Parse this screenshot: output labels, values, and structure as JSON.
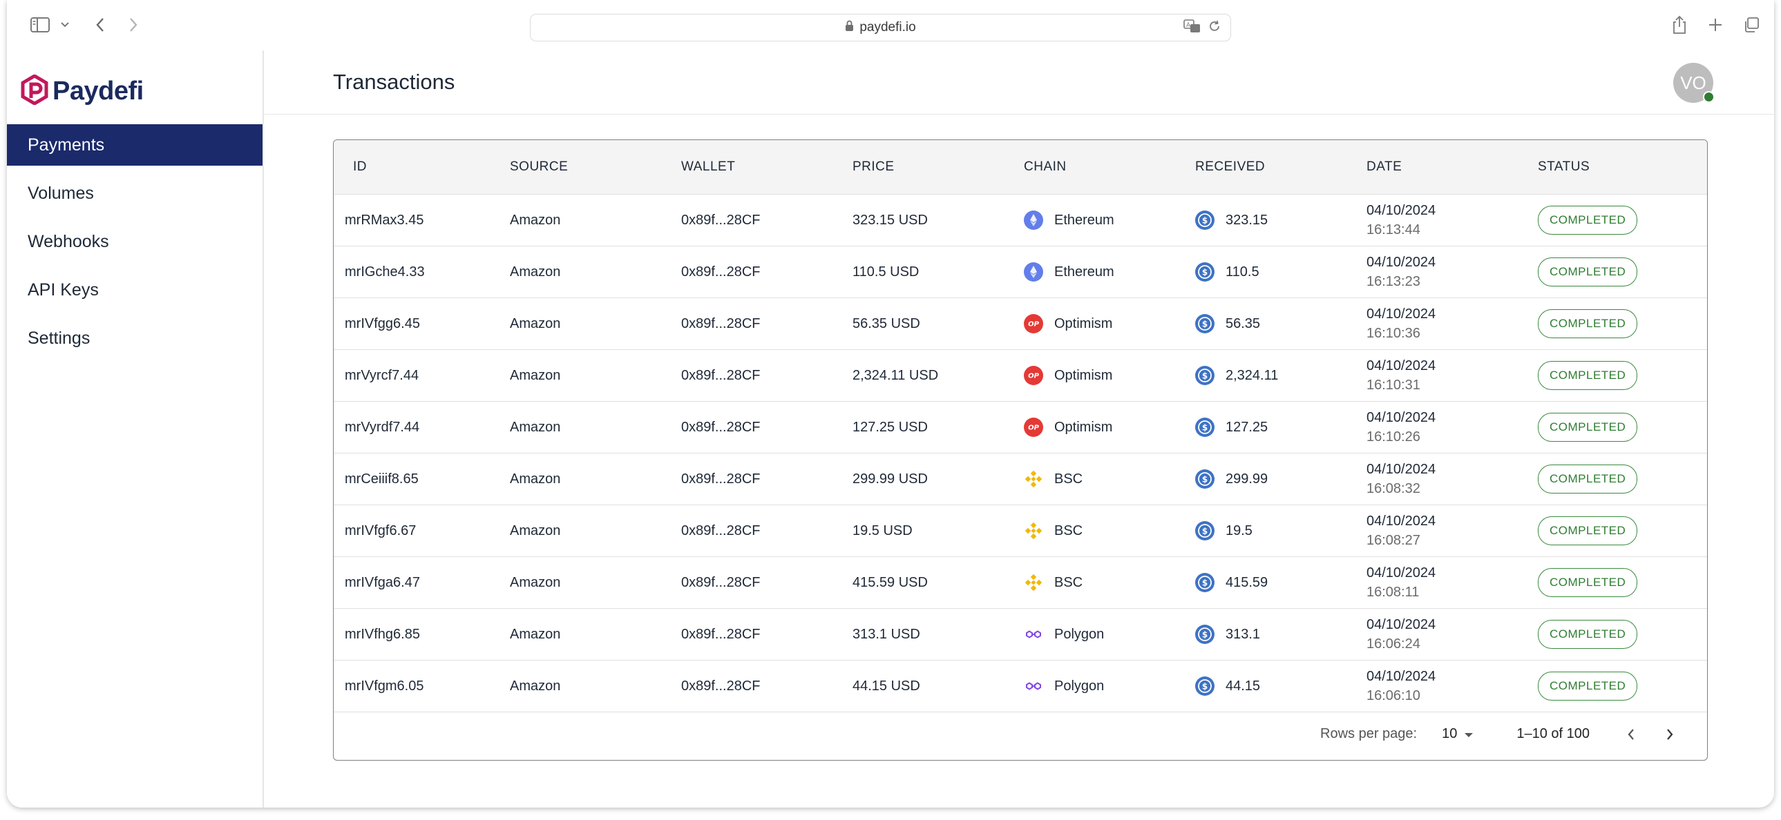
{
  "browser": {
    "url": "paydefi.io"
  },
  "brand": {
    "name": "Paydefi",
    "primary_color": "#1b2a6b",
    "logo_color": "#c2185b"
  },
  "sidebar": {
    "items": [
      {
        "label": "Payments",
        "active": true
      },
      {
        "label": "Volumes",
        "active": false
      },
      {
        "label": "Webhooks",
        "active": false
      },
      {
        "label": "API Keys",
        "active": false
      },
      {
        "label": "Settings",
        "active": false
      }
    ]
  },
  "header": {
    "title": "Transactions",
    "avatar_initials": "VO",
    "online_status_color": "#2e7d32"
  },
  "table": {
    "columns": [
      "ID",
      "SOURCE",
      "WALLET",
      "PRICE",
      "CHAIN",
      "RECEIVED",
      "DATE",
      "STATUS"
    ],
    "rows": [
      {
        "id": "mrRMax3.45",
        "source": "Amazon",
        "wallet": "0x89f...28CF",
        "price": "323.15 USD",
        "chain": "Ethereum",
        "chain_icon": "ethereum-icon",
        "received": "323.15",
        "date": "04/10/2024",
        "time": "16:13:44",
        "status": "COMPLETED"
      },
      {
        "id": "mrIGche4.33",
        "source": "Amazon",
        "wallet": "0x89f...28CF",
        "price": "110.5 USD",
        "chain": "Ethereum",
        "chain_icon": "ethereum-icon",
        "received": "110.5",
        "date": "04/10/2024",
        "time": "16:13:23",
        "status": "COMPLETED"
      },
      {
        "id": "mrIVfgg6.45",
        "source": "Amazon",
        "wallet": "0x89f...28CF",
        "price": "56.35 USD",
        "chain": "Optimism",
        "chain_icon": "optimism-icon",
        "received": "56.35",
        "date": "04/10/2024",
        "time": "16:10:36",
        "status": "COMPLETED"
      },
      {
        "id": "mrVyrcf7.44",
        "source": "Amazon",
        "wallet": "0x89f...28CF",
        "price": "2,324.11 USD",
        "chain": "Optimism",
        "chain_icon": "optimism-icon",
        "received": "2,324.11",
        "date": "04/10/2024",
        "time": "16:10:31",
        "status": "COMPLETED"
      },
      {
        "id": "mrVyrdf7.44",
        "source": "Amazon",
        "wallet": "0x89f...28CF",
        "price": "127.25 USD",
        "chain": "Optimism",
        "chain_icon": "optimism-icon",
        "received": "127.25",
        "date": "04/10/2024",
        "time": "16:10:26",
        "status": "COMPLETED"
      },
      {
        "id": "mrCeiiif8.65",
        "source": "Amazon",
        "wallet": "0x89f...28CF",
        "price": "299.99 USD",
        "chain": "BSC",
        "chain_icon": "bsc-icon",
        "received": "299.99",
        "date": "04/10/2024",
        "time": "16:08:32",
        "status": "COMPLETED"
      },
      {
        "id": "mrIVfgf6.67",
        "source": "Amazon",
        "wallet": "0x89f...28CF",
        "price": "19.5 USD",
        "chain": "BSC",
        "chain_icon": "bsc-icon",
        "received": "19.5",
        "date": "04/10/2024",
        "time": "16:08:27",
        "status": "COMPLETED"
      },
      {
        "id": "mrIVfga6.47",
        "source": "Amazon",
        "wallet": "0x89f...28CF",
        "price": "415.59 USD",
        "chain": "BSC",
        "chain_icon": "bsc-icon",
        "received": "415.59",
        "date": "04/10/2024",
        "time": "16:08:11",
        "status": "COMPLETED"
      },
      {
        "id": "mrIVfhg6.85",
        "source": "Amazon",
        "wallet": "0x89f...28CF",
        "price": "313.1 USD",
        "chain": "Polygon",
        "chain_icon": "polygon-icon",
        "received": "313.1",
        "date": "04/10/2024",
        "time": "16:06:24",
        "status": "COMPLETED"
      },
      {
        "id": "mrIVfgm6.05",
        "source": "Amazon",
        "wallet": "0x89f...28CF",
        "price": "44.15 USD",
        "chain": "Polygon",
        "chain_icon": "polygon-icon",
        "received": "44.15",
        "date": "04/10/2024",
        "time": "16:06:10",
        "status": "COMPLETED"
      }
    ]
  },
  "pagination": {
    "rows_per_page_label": "Rows per page:",
    "rows_per_page_value": "10",
    "range_label": "1–10 of 100"
  }
}
